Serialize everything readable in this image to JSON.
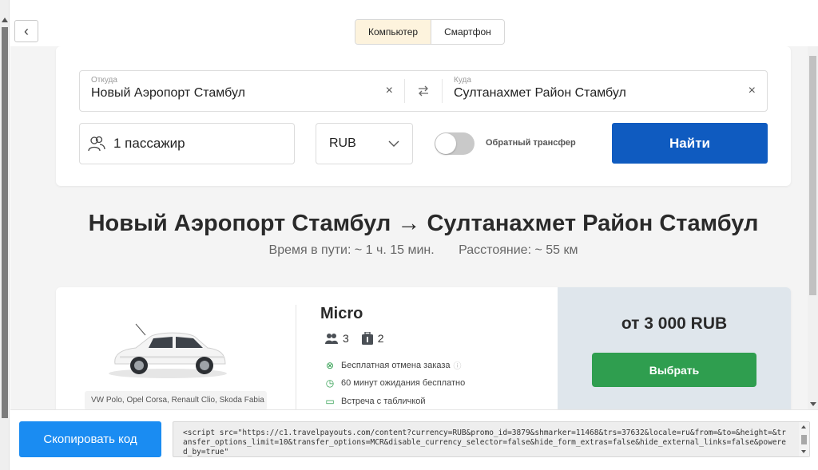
{
  "toolbar": {
    "back_glyph": "‹",
    "device_options": [
      "Компьютер",
      "Смартфон"
    ],
    "active_device": "Компьютер"
  },
  "search": {
    "from_label": "Откуда",
    "from_value": "Новый Аэропорт Стамбул",
    "to_label": "Куда",
    "to_value": "Султанахмет Район Стамбул",
    "clear_glyph": "×",
    "swap_glyph": "⇄",
    "passengers": "1 пассажир",
    "currency": "RUB",
    "return_transfer_label": "Обратный трансфер",
    "return_transfer_on": false,
    "find_button": "Найти"
  },
  "route": {
    "title": "Новый Аэропорт Стамбул → Султанахмет Район Стамбул",
    "travel_time": "Время в пути: ~ 1 ч. 15 мин.",
    "distance": "Расстояние: ~ 55 км"
  },
  "offer": {
    "class_name": "Micro",
    "passengers": "3",
    "luggage": "2",
    "car_models": "VW Polo, Opel Corsa, Renault Clio, Skoda Fabia и",
    "features": [
      "Бесплатная отмена заказа",
      "60 минут ожидания бесплатно",
      "Встреча с табличкой"
    ],
    "price": "от 3 000 RUB",
    "choose_button": "Выбрать"
  },
  "bottom": {
    "copy_button": "Скопировать код",
    "code": "<script src=\"https://c1.travelpayouts.com/content?currency=RUB&promo_id=3879&shmarker=11468&trs=37632&locale=ru&from=&to=&height=&transfer_options_limit=10&transfer_options=MCR&disable_currency_selector=false&hide_form_extras=false&hide_external_links=false&powered_by=true\""
  },
  "colors": {
    "primary_button": "#0f5bc0",
    "choose_button": "#2f9e4f",
    "copy_button": "#1a8cf2",
    "price_panel": "#dfe6ec"
  }
}
